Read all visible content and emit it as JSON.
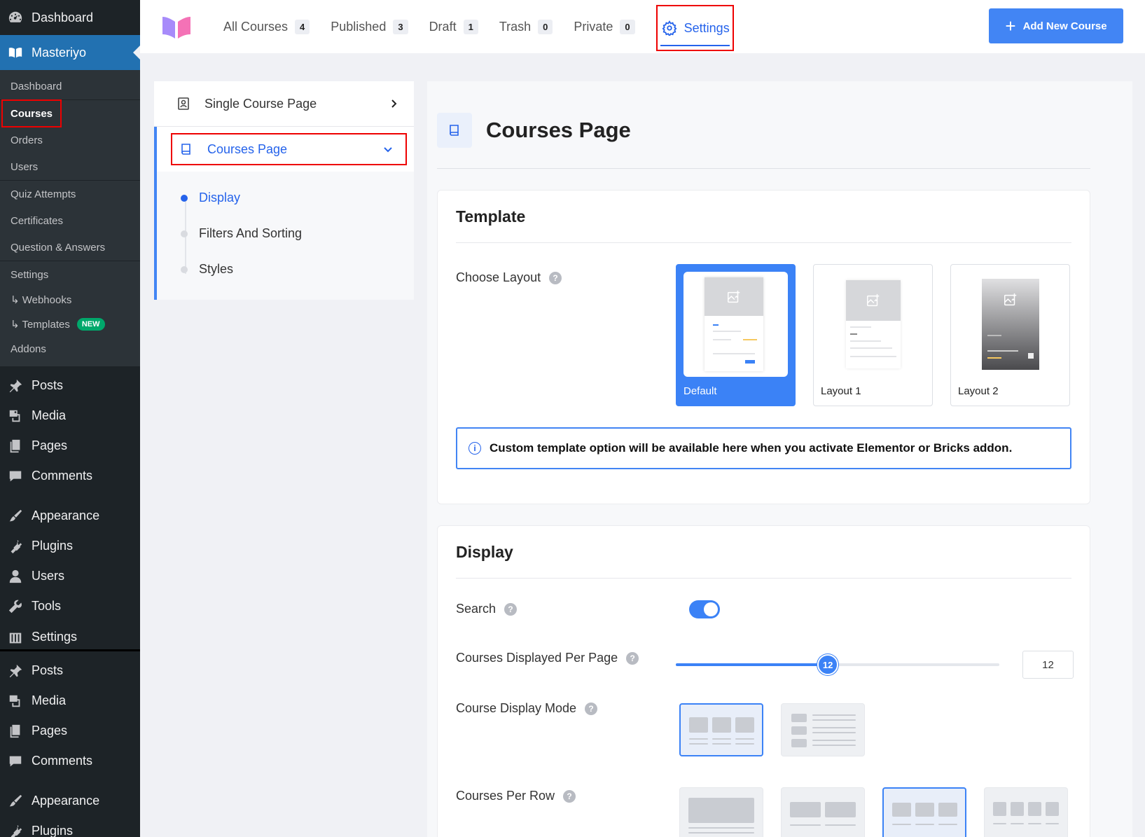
{
  "wp_sidebar": {
    "dashboard": "Dashboard",
    "masteriyo": "Masteriyo",
    "submenu": [
      {
        "label": "Dashboard"
      },
      {
        "label": "Courses"
      },
      {
        "label": "Orders"
      },
      {
        "label": "Users"
      },
      {
        "label": "Quiz Attempts"
      },
      {
        "label": "Certificates"
      },
      {
        "label": "Question & Answers"
      },
      {
        "label": "Settings"
      },
      {
        "label": "↳ Webhooks"
      },
      {
        "label": "↳ Templates"
      },
      {
        "label": "Addons"
      }
    ],
    "new_badge": "NEW",
    "menu": [
      "Posts",
      "Media",
      "Pages",
      "Comments",
      "Appearance",
      "Plugins",
      "Users",
      "Tools",
      "Settings"
    ],
    "menu2": [
      "Posts",
      "Media",
      "Pages",
      "Comments",
      "Appearance",
      "Plugins"
    ]
  },
  "topbar": {
    "tabs": [
      {
        "label": "All Courses",
        "count": "4"
      },
      {
        "label": "Published",
        "count": "3"
      },
      {
        "label": "Draft",
        "count": "1"
      },
      {
        "label": "Trash",
        "count": "0"
      },
      {
        "label": "Private",
        "count": "0"
      }
    ],
    "settings_label": "Settings",
    "add_button": "Add New Course"
  },
  "settings_nav": {
    "single_course": "Single Course Page",
    "courses_page": "Courses Page",
    "sub_items": [
      "Display",
      "Filters And Sorting",
      "Styles"
    ]
  },
  "main": {
    "title": "Courses Page",
    "template": {
      "heading": "Template",
      "choose_layout": "Choose Layout",
      "layouts": [
        "Default",
        "Layout 1",
        "Layout 2"
      ],
      "selected_layout": "Default",
      "info": "Custom template option will be available here when you activate Elementor or Bricks addon."
    },
    "display": {
      "heading": "Display",
      "search_label": "Search",
      "search_enabled": true,
      "per_page_label": "Courses Displayed Per Page",
      "per_page_value": "12",
      "per_page_fraction": 0.47,
      "display_mode_label": "Course Display Mode",
      "per_row_label": "Courses Per Row"
    }
  },
  "colors": {
    "accent": "#3b82f6",
    "wp_sidebar": "#1d2327",
    "wp_active": "#2271b1",
    "highlight_box": "#ee0000",
    "new_badge": "#00a86b"
  }
}
